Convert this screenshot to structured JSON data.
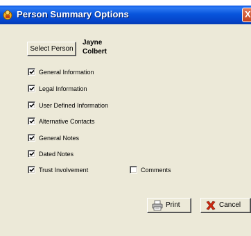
{
  "window": {
    "title": "Person Summary Options",
    "close_glyph": "X"
  },
  "select_person": {
    "button_label": "Select Person",
    "first_name": "Jayne",
    "last_name": "Colbert"
  },
  "options": [
    {
      "label": "General Information",
      "checked": true
    },
    {
      "label": "Legal Information",
      "checked": true
    },
    {
      "label": "User Defined Information",
      "checked": true
    },
    {
      "label": "Alternative Contacts",
      "checked": true
    },
    {
      "label": "General Notes",
      "checked": true
    },
    {
      "label": "Dated Notes",
      "checked": true
    },
    {
      "label": "Trust Involvement",
      "checked": true
    }
  ],
  "comments_option": {
    "label": "Comments",
    "checked": false
  },
  "buttons": {
    "print_label": "Print",
    "cancel_label": "Cancel"
  },
  "icons": {
    "title": "app-icon",
    "print": "printer-icon",
    "cancel": "cancel-icon"
  }
}
